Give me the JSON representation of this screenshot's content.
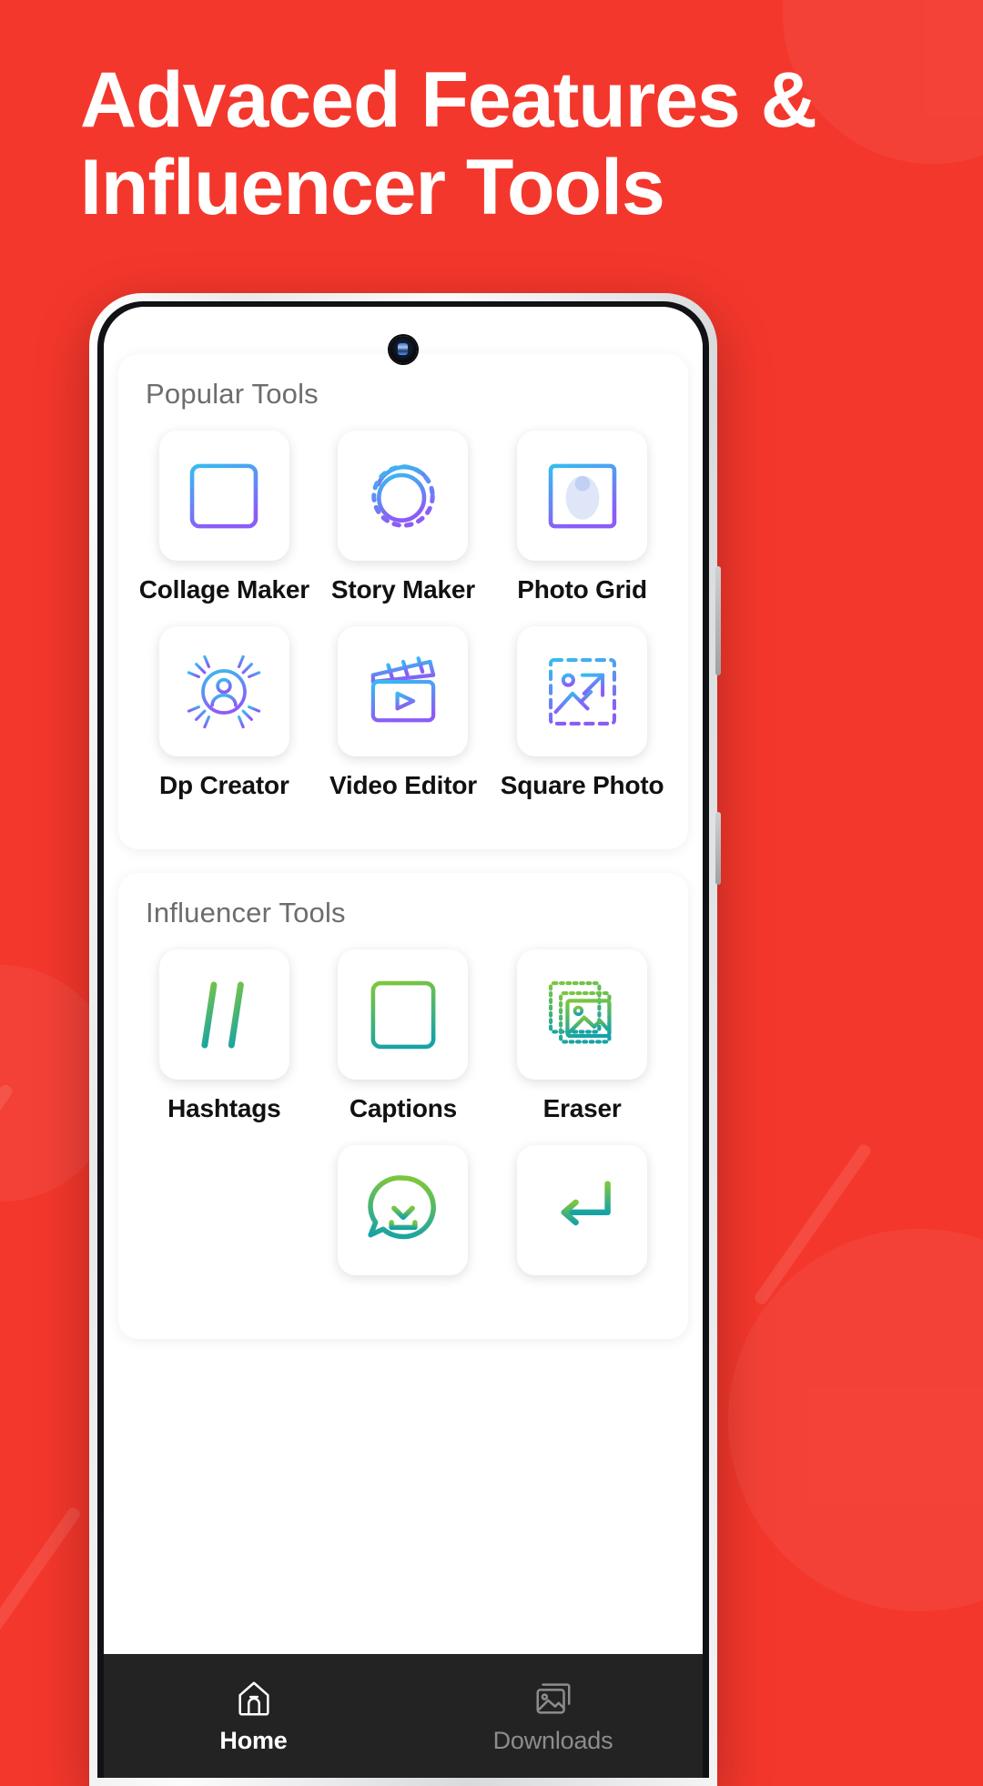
{
  "promo": {
    "headline_line1": "Advaced Features &",
    "headline_line2": "Influencer Tools",
    "background_color": "#F4372C",
    "headline_color": "#FFFFFF"
  },
  "phone": {
    "camera_icon": "front-camera-punch-hole"
  },
  "app": {
    "sections": [
      {
        "title": "Popular Tools",
        "accent_from": "#35BDF0",
        "accent_to": "#8B5CF6",
        "tools": [
          {
            "label": "Collage Maker",
            "icon": "collage-grid-icon"
          },
          {
            "label": "Story Maker",
            "icon": "story-circle-plus-icon"
          },
          {
            "label": "Photo Grid",
            "icon": "photo-grid-icon"
          },
          {
            "label": "Dp Creator",
            "icon": "dp-sunburst-person-icon"
          },
          {
            "label": "Video Editor",
            "icon": "clapperboard-play-icon"
          },
          {
            "label": "Square Photo",
            "icon": "square-photo-resize-icon"
          }
        ]
      },
      {
        "title": "Influencer Tools",
        "accent_from": "#7CC63F",
        "accent_to": "#17A3A6",
        "tools": [
          {
            "label": "Hashtags",
            "icon": "hashtag-icon"
          },
          {
            "label": "Captions",
            "icon": "captions-document-icon"
          },
          {
            "label": "Eraser",
            "icon": "eraser-photo-stack-icon"
          },
          {
            "label": "",
            "icon": "whatsapp-status-download-icon"
          },
          {
            "label": "",
            "icon": "repost-arrow-icon"
          }
        ]
      }
    ],
    "bottom_nav": [
      {
        "label": "Home",
        "icon": "home-icon",
        "active": true
      },
      {
        "label": "Downloads",
        "icon": "downloads-image-icon",
        "active": false
      }
    ]
  }
}
